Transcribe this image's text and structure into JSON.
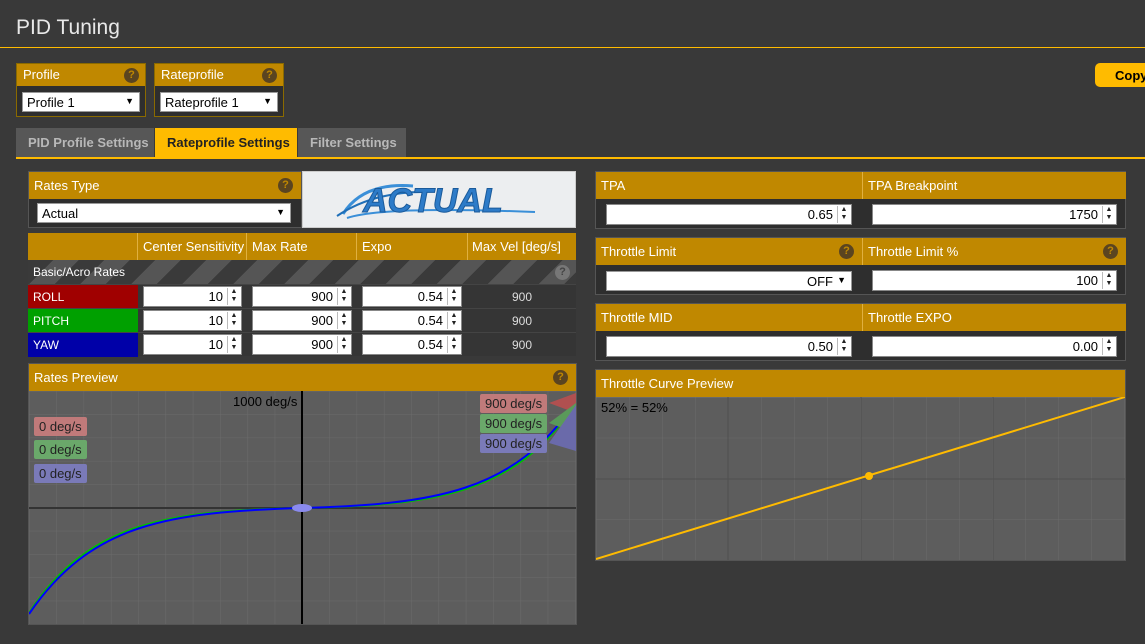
{
  "header": {
    "title": "PID Tuning"
  },
  "profile": {
    "label": "Profile",
    "help": "?",
    "value": "Profile 1"
  },
  "rateprofile": {
    "label": "Rateprofile",
    "help": "?",
    "value": "Rateprofile 1"
  },
  "copy_button": {
    "label": "Copy"
  },
  "tabs": [
    {
      "label": "PID Profile Settings",
      "active": false
    },
    {
      "label": "Rateprofile Settings",
      "active": true
    },
    {
      "label": "Filter Settings",
      "active": false
    }
  ],
  "rates_type": {
    "label": "Rates Type",
    "help": "?",
    "value": "Actual",
    "logo_text": "ACTUAL"
  },
  "rates_table": {
    "headers": [
      "Center Sensitivity",
      "Max Rate",
      "Expo",
      "Max Vel [deg/s]"
    ],
    "section_label": "Basic/Acro Rates",
    "help": "?",
    "rows": [
      {
        "axis": "ROLL",
        "color": "#a00000",
        "center": "10",
        "max_rate": "900",
        "expo": "0.54",
        "max_vel": "900"
      },
      {
        "axis": "PITCH",
        "color": "#00a000",
        "center": "10",
        "max_rate": "900",
        "expo": "0.54",
        "max_vel": "900"
      },
      {
        "axis": "YAW",
        "color": "#0000a8",
        "center": "10",
        "max_rate": "900",
        "expo": "0.54",
        "max_vel": "900"
      }
    ]
  },
  "rates_preview": {
    "label": "Rates Preview",
    "help": "?",
    "axis_label": "1000 deg/s",
    "current": [
      "0 deg/s",
      "0 deg/s",
      "0 deg/s"
    ],
    "max": [
      "900 deg/s",
      "900 deg/s",
      "900 deg/s"
    ]
  },
  "tpa": {
    "label": "TPA",
    "value": "0.65"
  },
  "tpa_breakpoint": {
    "label": "TPA Breakpoint",
    "value": "1750"
  },
  "throttle_limit": {
    "label": "Throttle Limit",
    "help": "?",
    "value": "OFF"
  },
  "throttle_limit_pct": {
    "label": "Throttle Limit %",
    "help": "?",
    "value": "100"
  },
  "throttle_mid": {
    "label": "Throttle MID",
    "value": "0.50"
  },
  "throttle_expo": {
    "label": "Throttle EXPO",
    "value": "0.00"
  },
  "throttle_preview": {
    "label": "Throttle Curve Preview",
    "readout": "52% = 52%"
  },
  "colors": {
    "accent": "#ffbb00",
    "header_bar": "#c08800",
    "roll": "#a00000",
    "pitch": "#00a000",
    "yaw": "#0000a8"
  }
}
